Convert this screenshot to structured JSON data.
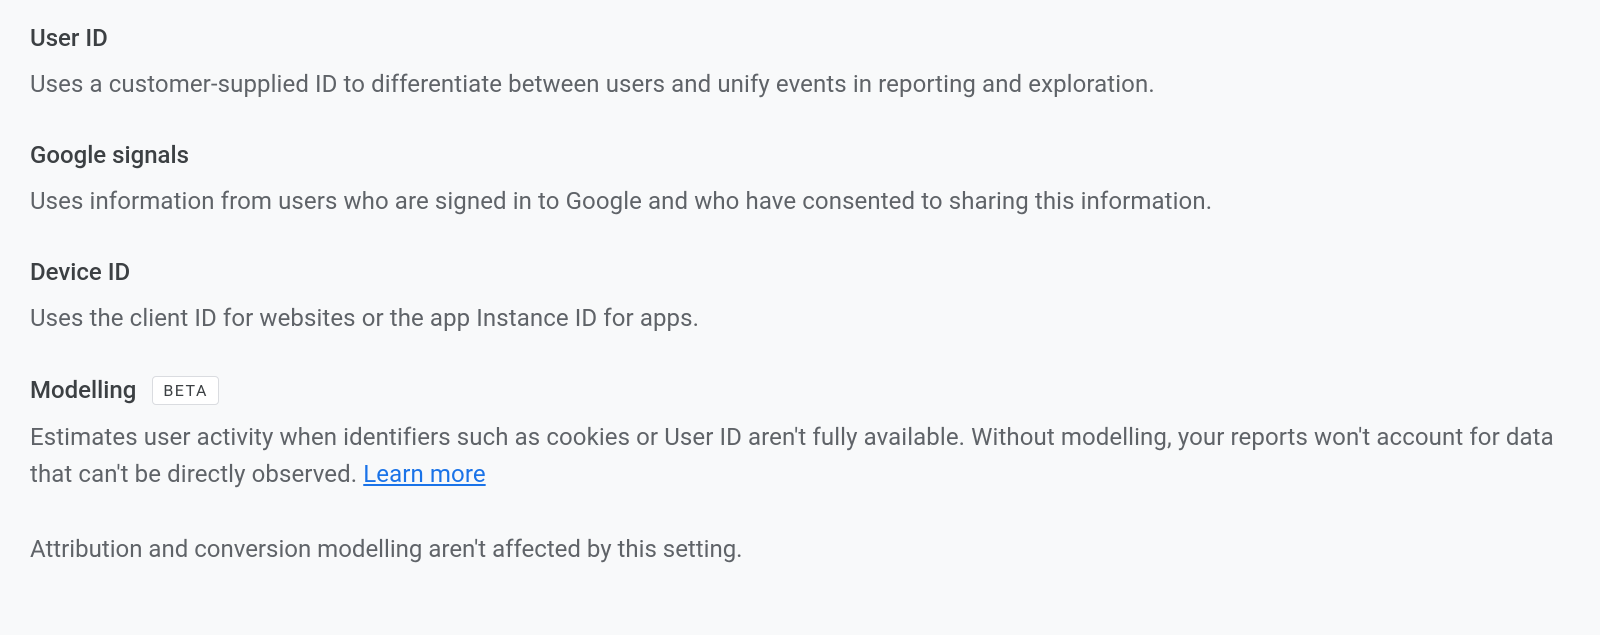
{
  "sections": [
    {
      "title": "User ID",
      "description": "Uses a customer-supplied ID to differentiate between users and unify events in reporting and exploration."
    },
    {
      "title": "Google signals",
      "description": "Uses information from users who are signed in to Google and who have consented to sharing this information."
    },
    {
      "title": "Device ID",
      "description": "Uses the client ID for websites or the app Instance ID for apps."
    },
    {
      "title": "Modelling",
      "badge": "BETA",
      "description_part1": "Estimates user activity when identifiers such as cookies or User ID aren't fully available. Without modelling, your reports won't account for data that can't be directly observed. ",
      "link_text": "Learn more"
    }
  ],
  "footer_note": "Attribution and conversion modelling aren't affected by this setting."
}
